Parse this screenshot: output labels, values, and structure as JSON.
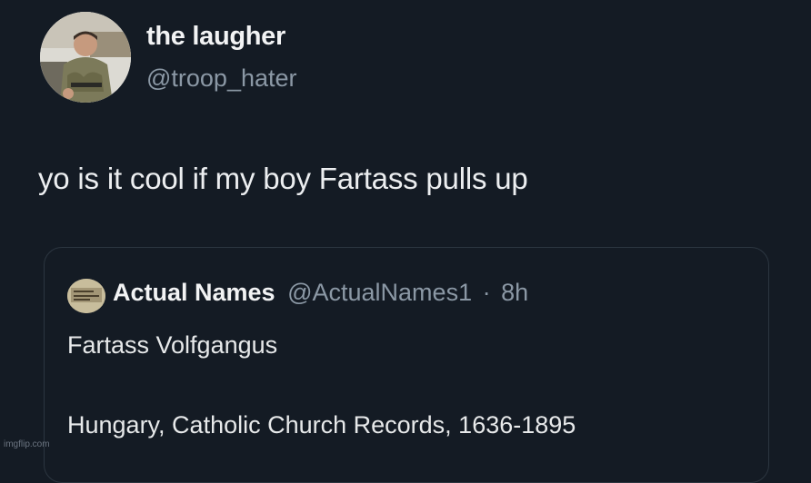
{
  "author": {
    "display_name": "the laugher",
    "handle": "@troop_hater",
    "avatar_icon": "soldier-photo-avatar"
  },
  "tweet": {
    "text": "yo is it cool if my boy Fartass pulls up"
  },
  "quoted_tweet": {
    "display_name": "Actual Names",
    "handle": "@ActualNames1",
    "separator": "·",
    "time": "8h",
    "line1": "Fartass Volfgangus",
    "line2": "Hungary, Catholic Church Records, 1636-1895",
    "avatar_icon": "old-document-avatar"
  },
  "watermark": "imgflip.com",
  "colors": {
    "background": "#141b24",
    "primary_text": "#e7e9ea",
    "secondary_text": "#8b98a5",
    "card_border": "#2c3640"
  }
}
